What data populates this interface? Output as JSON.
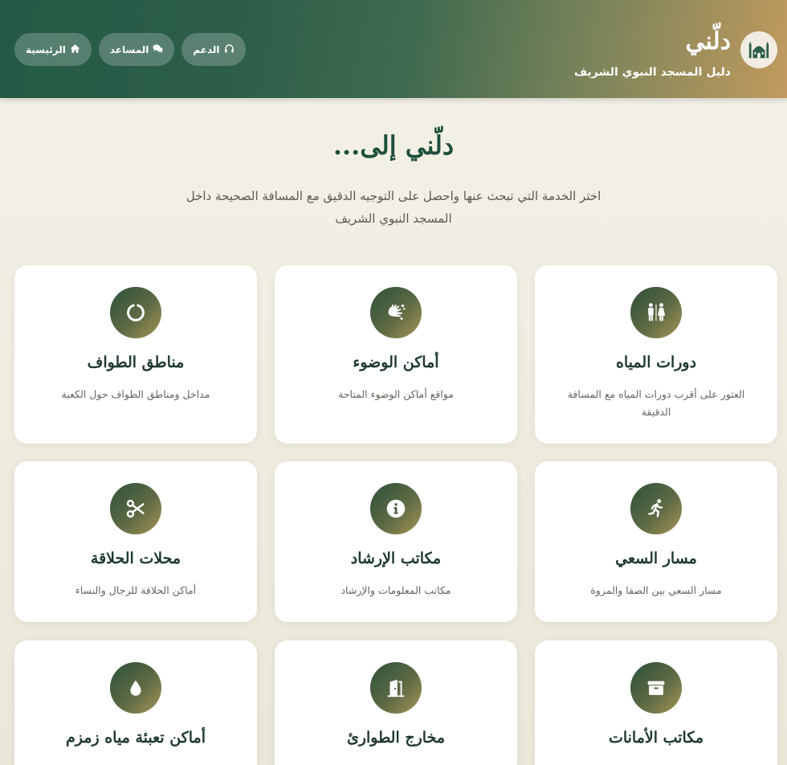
{
  "header": {
    "title": "دلّني",
    "subtitle": "دليل المسجد النبوي الشريف",
    "nav": [
      {
        "label": "الرئيسية",
        "icon": "home-icon"
      },
      {
        "label": "المساعد",
        "icon": "chat-icon"
      },
      {
        "label": "الدعم",
        "icon": "headset-icon"
      }
    ]
  },
  "hero": {
    "title": "دلّني إلى...",
    "description": "اختر الخدمة التي تبحث عنها واحصل على التوجيه الدقيق مع المسافة الصحيحة داخل المسجد النبوي الشريف"
  },
  "services": [
    {
      "title": "دورات المياه",
      "description": "العثور على أقرب دورات المياه مع المسافة الدقيقة",
      "icon": "restroom-icon"
    },
    {
      "title": "أماكن الوضوء",
      "description": "مواقع أماكن الوضوء المتاحة",
      "icon": "hands-wash-icon"
    },
    {
      "title": "مناطق الطواف",
      "description": "مداخل ومناطق الطواف حول الكعبة",
      "icon": "circle-icon"
    },
    {
      "title": "مسار السعي",
      "description": "مسار السعي بين الصفا والمروة",
      "icon": "running-icon"
    },
    {
      "title": "مكاتب الإرشاد",
      "description": "مكاتب المعلومات والإرشاد",
      "icon": "info-icon"
    },
    {
      "title": "محلات الحلاقة",
      "description": "أماكن الحلاقة للرجال والنساء",
      "icon": "scissors-icon"
    },
    {
      "title": "مكاتب الأمانات",
      "description": "",
      "icon": "archive-box-icon"
    },
    {
      "title": "مخارج الطوارئ",
      "description": "",
      "icon": "door-exit-icon"
    },
    {
      "title": "أماكن تعبئة مياه زمزم",
      "description": "",
      "icon": "water-drop-icon"
    }
  ]
}
